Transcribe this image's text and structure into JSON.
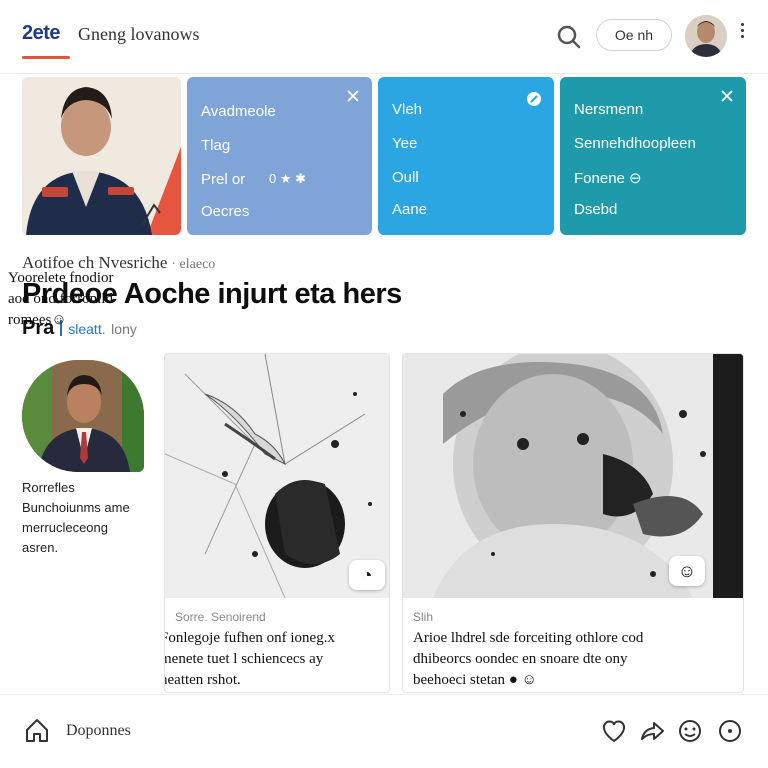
{
  "header": {
    "logo": "2ete",
    "title": "Gneng lovanows",
    "pill_button": "Oe nh"
  },
  "featured": {
    "card_a": {
      "lines": [
        "Avadmeole",
        "Tlag",
        "Prel or",
        "Oecres"
      ],
      "meta": "0 ★ ✱"
    },
    "card_b": {
      "lines": [
        "Vleh",
        "Yee",
        "Oull",
        "Aane"
      ]
    },
    "card_c": {
      "lines": [
        "Nersmenn",
        "Sennehdhoopleen",
        "Fonene ⊖",
        "Dsebd"
      ]
    }
  },
  "section": {
    "breadcrumb": "Aotifoe ch Nvesriche",
    "breadcrumb_sub": "· elaeco",
    "headline": "Prdeoe Aoche injurt eta hers",
    "byline_label": "Pra",
    "byline_author": "sleatt.",
    "byline_rest": "lony"
  },
  "left_column": {
    "text_lines": [
      "Rorrefles",
      "Bunchoiunms ame",
      "merrucleceong",
      "asren."
    ],
    "bottom_lines": [
      "Yoorelete fnodior",
      "aod ond forronild",
      "romees☺"
    ]
  },
  "articles": [
    {
      "label": "Sorre. Senoirend",
      "lines": [
        "Fonlegoje fufhen onf ioneg.x",
        "menete tuet l schiencecs ay",
        "neatten rshot."
      ]
    },
    {
      "label": "Slih",
      "lines": [
        "Arioe lhdrel sde forceiting othlore cod",
        "dhibeorcs oondec en snoare dte ony",
        "beehoeci stetan ● ☺"
      ]
    }
  ],
  "footer": {
    "label": "Doponnes"
  },
  "colors": {
    "card_a": "#7ea4d8",
    "card_b": "#2ba6e3",
    "card_c": "#1f9aab",
    "accent": "#e2553a",
    "link": "#1c76c8"
  }
}
